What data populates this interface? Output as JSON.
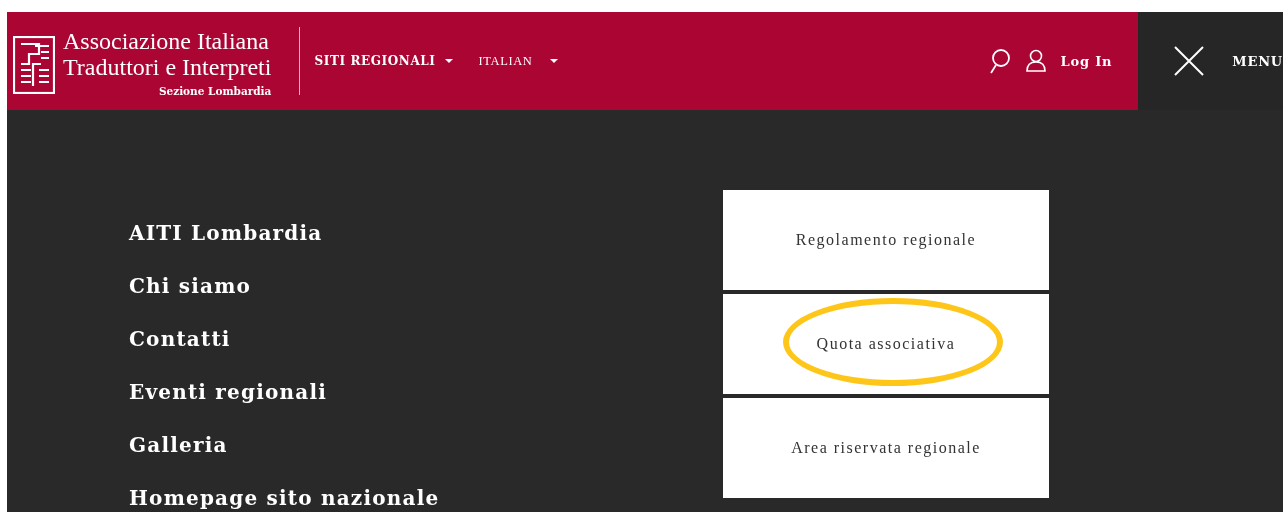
{
  "header": {
    "logo_lines": [
      "Associazione Italiana",
      "Traduttori e Interpreti"
    ],
    "logo_subtitle": "Sezione Lombardia",
    "nav": [
      {
        "label": "SITI REGIONALI",
        "kind": "dropdown"
      },
      {
        "label": "ITALIAN",
        "kind": "dropdown"
      }
    ],
    "login": "Log In",
    "menu": "MENU"
  },
  "menu_items": [
    {
      "label": "AITI Lombardia"
    },
    {
      "label": "Chi siamo"
    },
    {
      "label": "Contatti"
    },
    {
      "label": "Eventi regionali"
    },
    {
      "label": "Galleria"
    },
    {
      "label": "Homepage sito nazionale"
    }
  ],
  "submenu": [
    {
      "label": "Regolamento regionale",
      "highlighted": false
    },
    {
      "label": "Quota associativa",
      "highlighted": true
    },
    {
      "label": "Area riservata regionale",
      "highlighted": false
    }
  ]
}
